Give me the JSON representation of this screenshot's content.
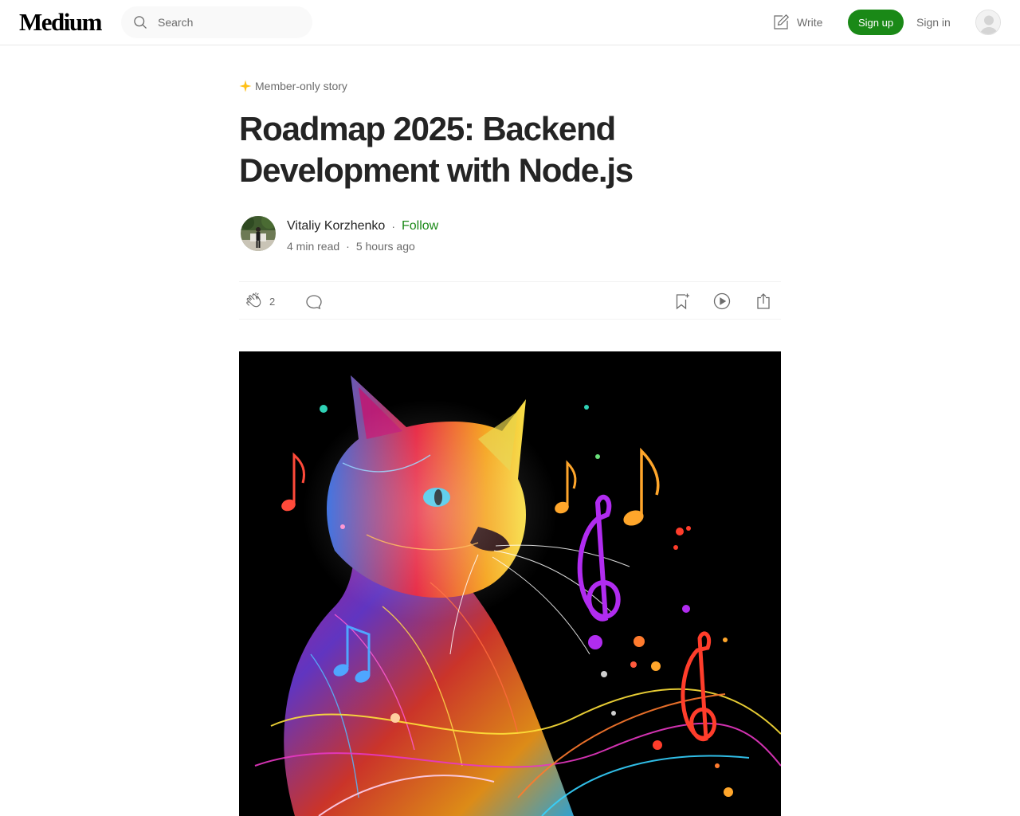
{
  "topbar": {
    "logo": "Medium",
    "search_placeholder": "Search",
    "write_label": "Write",
    "signup_label": "Sign up",
    "signin_label": "Sign in"
  },
  "article": {
    "badge": "Member-only story",
    "title": "Roadmap 2025: Backend Development with Node.js",
    "author": "Vitaliy Korzhenko",
    "separator": "·",
    "follow_label": "Follow",
    "read_time": "4 min read",
    "published": "5 hours ago"
  },
  "actions": {
    "clap_count": "2"
  },
  "colors": {
    "accent_green": "#1a8917",
    "star": "#ffc017",
    "text_primary": "#242424",
    "text_secondary": "#6b6b6b"
  },
  "icons": [
    "search-icon",
    "write-icon",
    "user-avatar-icon",
    "star-icon",
    "clap-icon",
    "comment-icon",
    "bookmark-icon",
    "listen-icon",
    "share-icon"
  ],
  "hero_image": {
    "subject": "neon rainbow cat with colorful music notes on black background"
  }
}
